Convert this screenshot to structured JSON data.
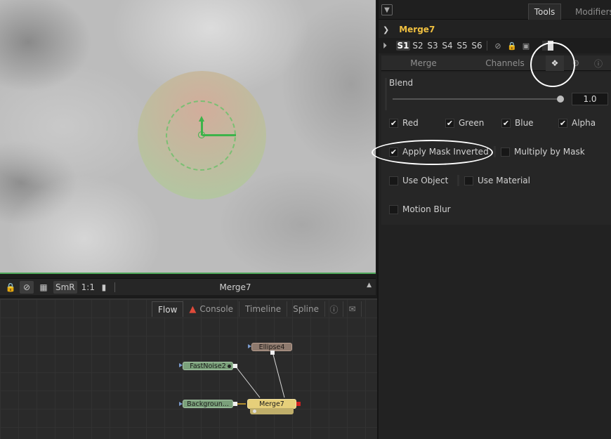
{
  "viewer": {
    "toolbar": {
      "smr_label": "SmR",
      "ratio_label": "1:1",
      "title": "Merge7"
    }
  },
  "flow": {
    "tabs": [
      {
        "label": "Flow"
      },
      {
        "label": "Console"
      },
      {
        "label": "Timeline"
      },
      {
        "label": "Spline"
      }
    ],
    "nodes": {
      "fastnoise": "FastNoise2",
      "background": "Backgroun...",
      "ellipse": "Ellipse4",
      "merge": "Merge7"
    }
  },
  "panel": {
    "tabs": {
      "tools": "Tools",
      "modifiers": "Modifiers"
    },
    "tool_name": "Merge7",
    "slots": [
      "S1",
      "S2",
      "S3",
      "S4",
      "S5",
      "S6"
    ],
    "subtabs": {
      "merge": "Merge",
      "channels": "Channels"
    },
    "blend": {
      "label": "Blend",
      "value": "1.0",
      "level": 1.0
    },
    "checkboxes": {
      "red": {
        "label": "Red",
        "checked": true
      },
      "green": {
        "label": "Green",
        "checked": true
      },
      "blue": {
        "label": "Blue",
        "checked": true
      },
      "alpha": {
        "label": "Alpha",
        "checked": true
      },
      "apply_mask_inverted": {
        "label": "Apply Mask Inverted",
        "checked": true
      },
      "multiply_by_mask": {
        "label": "Multiply by Mask",
        "checked": false
      },
      "use_object": {
        "label": "Use Object",
        "checked": false
      },
      "use_material": {
        "label": "Use Material",
        "checked": false
      },
      "motion_blur": {
        "label": "Motion Blur",
        "checked": false
      }
    }
  }
}
